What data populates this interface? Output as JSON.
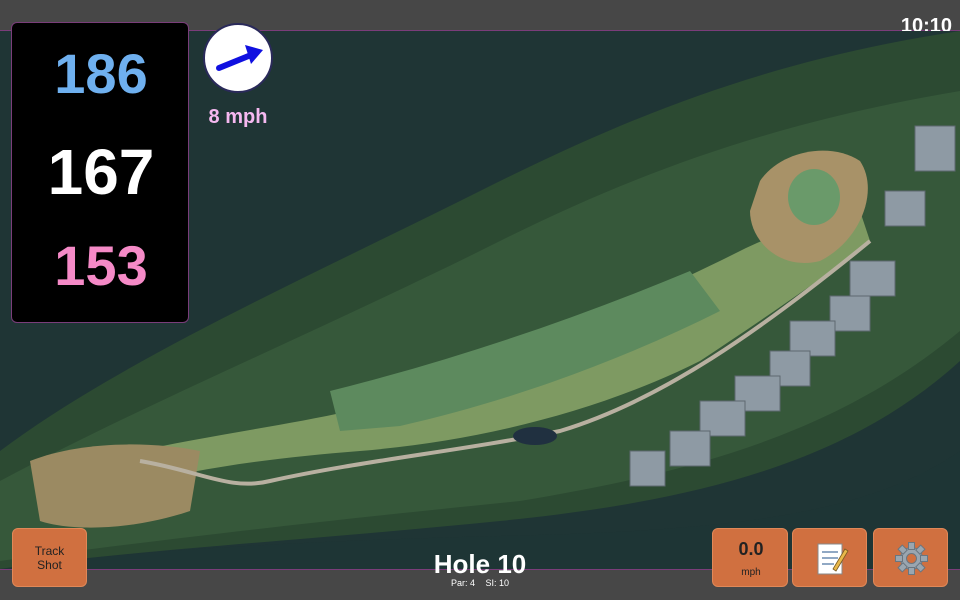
{
  "status": {
    "time": "10:10"
  },
  "distances": {
    "back": "186",
    "middle": "167",
    "front": "153"
  },
  "wind": {
    "speed": "8 mph",
    "icon": "wind-arrow-icon",
    "arrow_color": "#1010e0"
  },
  "hole": {
    "title": "Hole 10",
    "par": "Par: 4",
    "stroke_index": "SI: 10"
  },
  "buttons": {
    "track_shot_line1": "Track",
    "track_shot_line2": "Shot",
    "speed_value": "0.0",
    "speed_unit": "mph",
    "notes_icon": "notepad-icon",
    "settings_icon": "gear-icon"
  },
  "colors": {
    "back": "#6fb0ef",
    "middle": "#ffffff",
    "front": "#f58ac7",
    "button": "#d07040",
    "accent_border": "#7a3d7a"
  }
}
